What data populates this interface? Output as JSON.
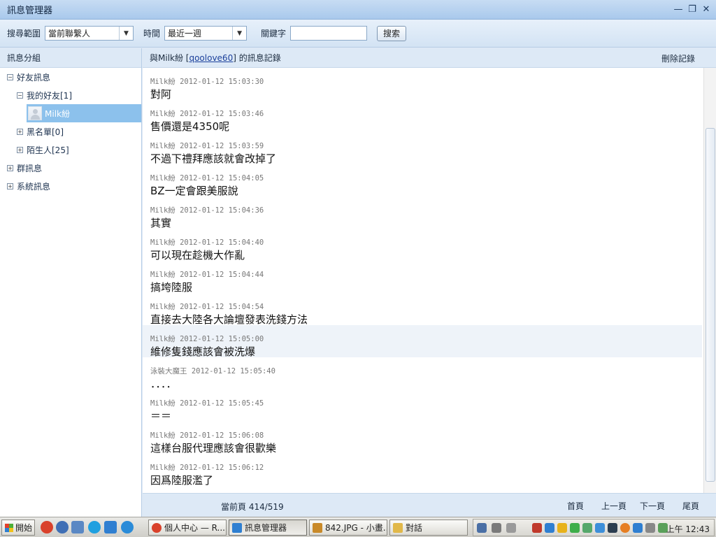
{
  "window": {
    "title": "訊息管理器",
    "minimize_glyph": "—",
    "maximize_glyph": "❐",
    "close_glyph": "✕"
  },
  "toolbar": {
    "scope_label": "搜尋範圍",
    "scope_value": "當前聯繫人",
    "time_label": "時間",
    "time_value": "最近一週",
    "keyword_label": "關鍵字",
    "keyword_value": "",
    "search_button": "搜索",
    "dropdown_glyph": "▼"
  },
  "sidebar": {
    "header": "訊息分組",
    "tree": {
      "friends": {
        "label": "好友訊息",
        "toggle": "−"
      },
      "my_friends": {
        "label": "我的好友[1]",
        "toggle": "−"
      },
      "contact": {
        "label": "Milk紛"
      },
      "blacklist": {
        "label": "黑名單[0]",
        "toggle": "+"
      },
      "strangers": {
        "label": "陌生人[25]",
        "toggle": "+"
      },
      "group": {
        "label": "群訊息",
        "toggle": "+"
      },
      "system": {
        "label": "系統訊息",
        "toggle": "+"
      }
    }
  },
  "main": {
    "header_prefix": "與Milk紛 [",
    "peer_id": "qoolove60",
    "header_suffix": "] 的訊息記錄",
    "delete_label": "刪除記錄",
    "messages": [
      {
        "meta": "Milk紛 2012-01-12 15:03:30",
        "text": "對阿"
      },
      {
        "meta": "Milk紛 2012-01-12 15:03:46",
        "text": "售價還是4350呢"
      },
      {
        "meta": "Milk紛 2012-01-12 15:03:59",
        "text": "不過下禮拜應該就會改掉了"
      },
      {
        "meta": "Milk紛 2012-01-12 15:04:05",
        "text": "BZ一定會跟美服說"
      },
      {
        "meta": "Milk紛 2012-01-12 15:04:36",
        "text": "其實"
      },
      {
        "meta": "Milk紛 2012-01-12 15:04:40",
        "text": "可以現在趁機大作亂"
      },
      {
        "meta": "Milk紛 2012-01-12 15:04:44",
        "text": "搞垮陸服"
      },
      {
        "meta": "Milk紛 2012-01-12 15:04:54",
        "text": "直接去大陸各大論壇發表洗錢方法"
      },
      {
        "meta": "Milk紛 2012-01-12 15:05:00",
        "text": "維修隻錢應該會被洗爆"
      },
      {
        "meta": "泳裝大魔王 2012-01-12 15:05:40",
        "text": "．．．．"
      },
      {
        "meta": "Milk紛 2012-01-12 15:05:45",
        "text": "＝＝"
      },
      {
        "meta": "Milk紛 2012-01-12 15:06:08",
        "text": "這樣台服代理應該會很歡樂"
      },
      {
        "meta": "Milk紛 2012-01-12 15:06:12",
        "text": "因爲陸服濫了"
      }
    ],
    "footer": {
      "current_page": "當前頁 414/519",
      "first": "首頁",
      "prev": "上一頁",
      "next": "下一頁",
      "last": "尾頁"
    }
  },
  "taskbar": {
    "start_label": "開始",
    "tasks": [
      {
        "label": "個人中心 — R...",
        "color": "#d9412b"
      },
      {
        "label": "訊息管理器",
        "color": "#2f7fd1"
      },
      {
        "label": "842.JPG - 小畫...",
        "color": "#c98a2a"
      },
      {
        "label": "對話",
        "color": "#e1b84a"
      }
    ],
    "clock": "上午 12:43"
  }
}
